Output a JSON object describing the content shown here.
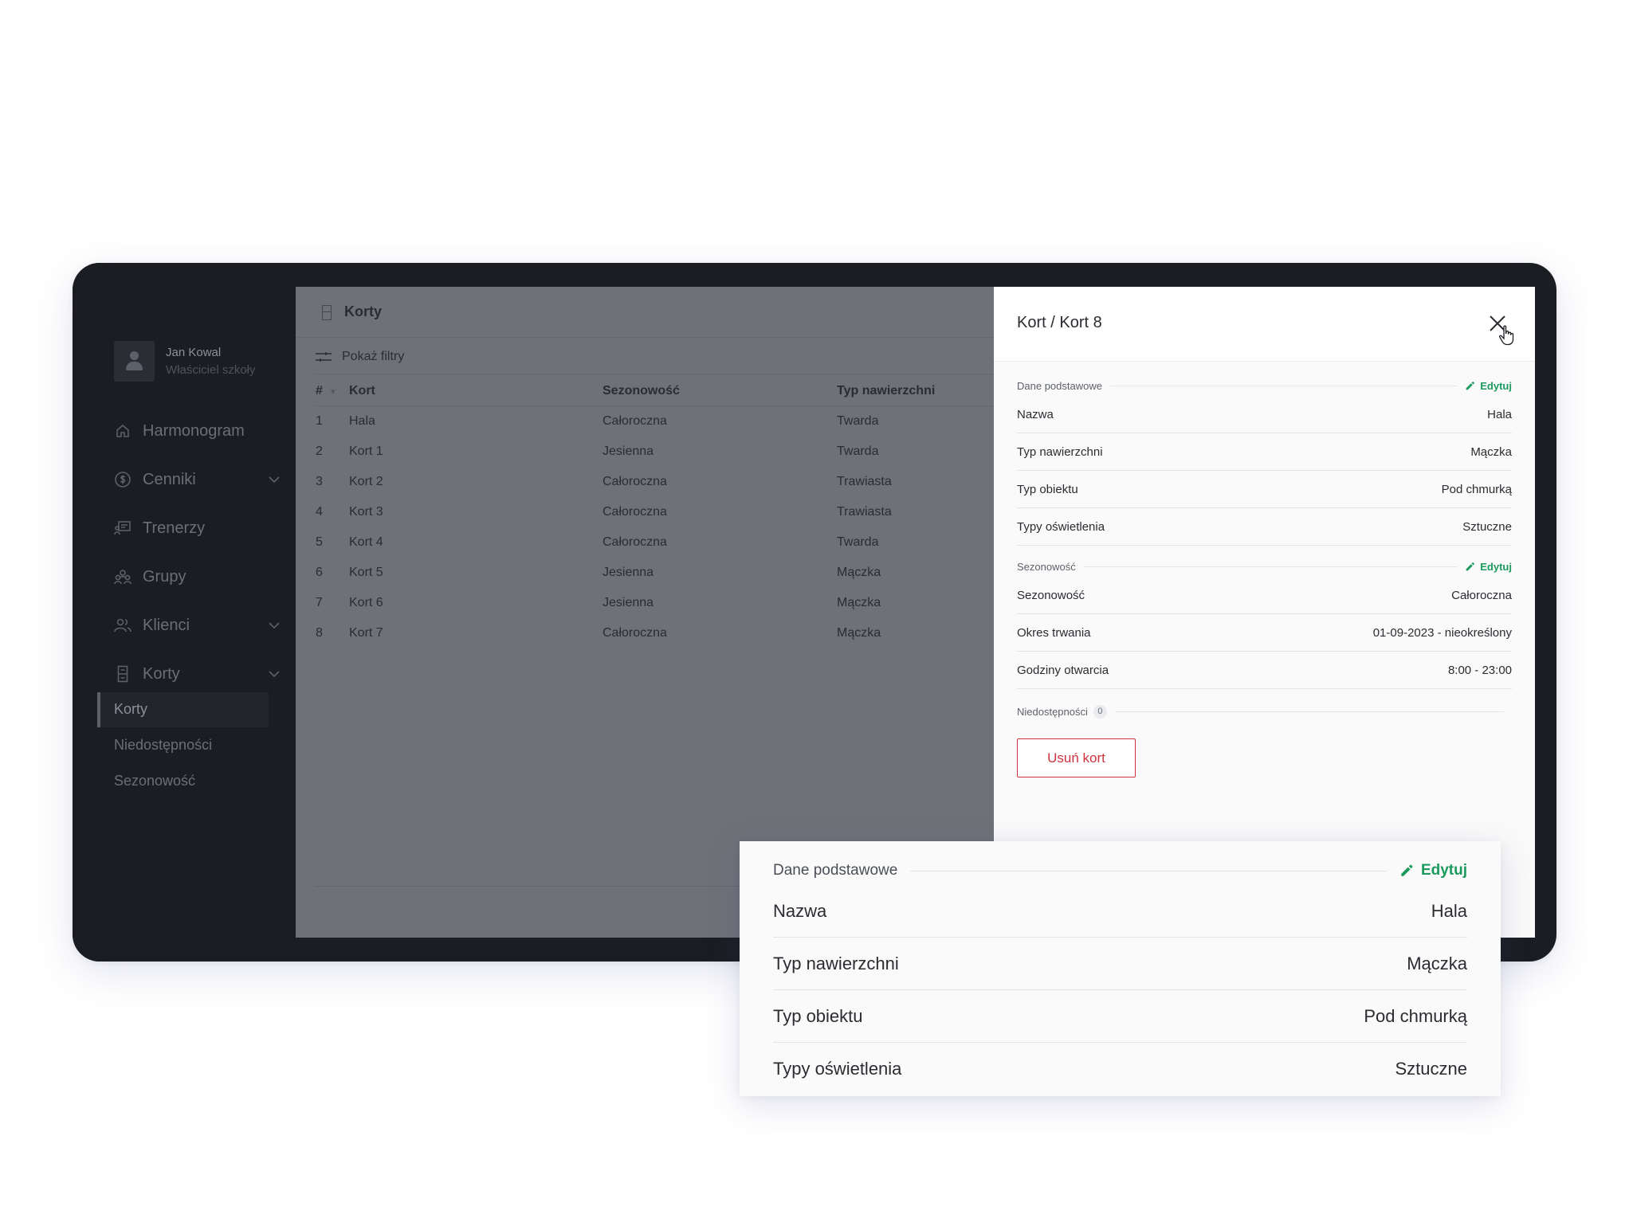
{
  "user": {
    "name": "Jan Kowal",
    "role": "Właściciel szkoły"
  },
  "nav": {
    "items": [
      {
        "label": "Harmonogram",
        "icon": "home-icon"
      },
      {
        "label": "Cenniki",
        "icon": "dollar-icon"
      },
      {
        "label": "Trenerzy",
        "icon": "whiteboard-icon"
      },
      {
        "label": "Grupy",
        "icon": "group-icon"
      },
      {
        "label": "Klienci",
        "icon": "users-icon"
      },
      {
        "label": "Korty",
        "icon": "court-icon"
      }
    ],
    "sub_items": [
      "Korty",
      "Niedostępności",
      "Sezonowość"
    ]
  },
  "main": {
    "title": "Korty",
    "filters_label": "Pokaż filtry",
    "columns": [
      "#",
      "Kort",
      "Sezonowość",
      "Typ nawierzchni"
    ],
    "rows": [
      [
        "1",
        "Hala",
        "Całoroczna",
        "Twarda"
      ],
      [
        "2",
        "Kort 1",
        "Jesienna",
        "Twarda"
      ],
      [
        "3",
        "Kort 2",
        "Całoroczna",
        "Trawiasta"
      ],
      [
        "4",
        "Kort 3",
        "Całoroczna",
        "Trawiasta"
      ],
      [
        "5",
        "Kort 4",
        "Całoroczna",
        "Twarda"
      ],
      [
        "6",
        "Kort 5",
        "Jesienna",
        "Mączka"
      ],
      [
        "7",
        "Kort 6",
        "Jesienna",
        "Mączka"
      ],
      [
        "8",
        "Kort 7",
        "Całoroczna",
        "Mączka"
      ]
    ]
  },
  "panel": {
    "title": "Kort / Kort 8",
    "edit_label": "Edytuj",
    "basic": {
      "label": "Dane podstawowe",
      "rows": [
        {
          "key": "Nazwa",
          "value": "Hala"
        },
        {
          "key": "Typ nawierzchni",
          "value": "Mączka"
        },
        {
          "key": "Typ obiektu",
          "value": "Pod chmurką"
        },
        {
          "key": "Typy oświetlenia",
          "value": "Sztuczne"
        }
      ]
    },
    "season": {
      "label": "Sezonowość",
      "rows": [
        {
          "key": "Sezonowość",
          "value": "Całoroczna"
        },
        {
          "key": "Okres trwania",
          "value": "01-09-2023 - nieokreślony"
        },
        {
          "key": "Godziny otwarcia",
          "value": "8:00 - 23:00"
        }
      ]
    },
    "unavailability": {
      "label": "Niedostępności",
      "count": "0"
    },
    "delete_label": "Usuń kort"
  },
  "colors": {
    "accent_green": "#1c9a5d",
    "danger_red": "#d0313f",
    "sidebar_bg": "#1b1d22"
  }
}
